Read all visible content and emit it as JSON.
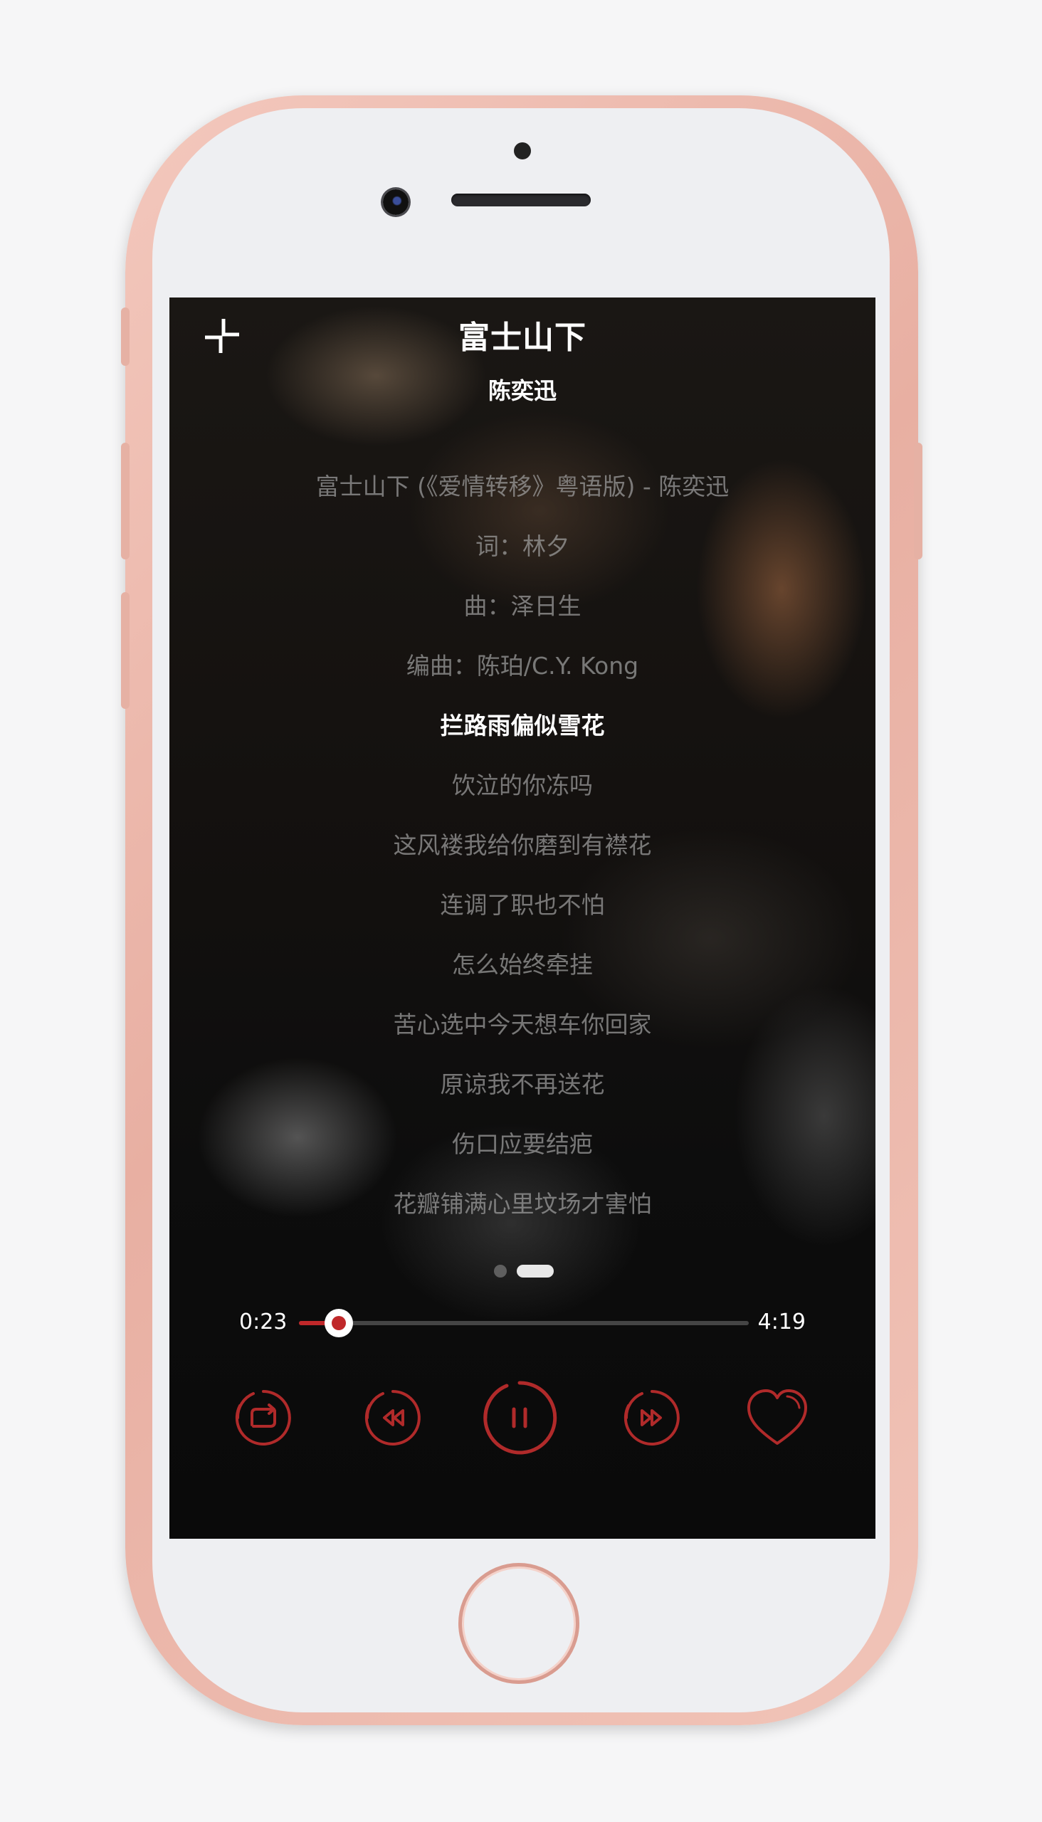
{
  "player": {
    "title": "富士山下",
    "artist": "陈奕迅"
  },
  "lyrics": [
    "富士山下 (《爱情转移》粤语版) - 陈奕迅",
    "词：林夕",
    "曲：泽日生",
    "编曲：陈珀/C.Y. Kong",
    "拦路雨偏似雪花",
    "饮泣的你冻吗",
    "这风褛我给你磨到有襟花",
    "连调了职也不怕",
    "怎么始终牵挂",
    "苦心选中今天想车你回家",
    "原谅我不再送花",
    "伤口应要结疤",
    "花瓣铺满心里坟场才害怕"
  ],
  "current_lyric_index": 4,
  "pager": {
    "page_count": 2,
    "active_page": 2
  },
  "progress": {
    "elapsed": "0:23",
    "total": "4:19",
    "fraction": 0.089
  },
  "controls": {
    "buttons": [
      "repeat-icon",
      "rewind-icon",
      "pause-icon",
      "fast-forward-icon",
      "heart-icon"
    ]
  },
  "colors": {
    "accent": "#c0282a",
    "phone_frame": "#eeb9ad",
    "lyric_dim": "#9b9b9b",
    "lyric_current": "#ffffff"
  }
}
